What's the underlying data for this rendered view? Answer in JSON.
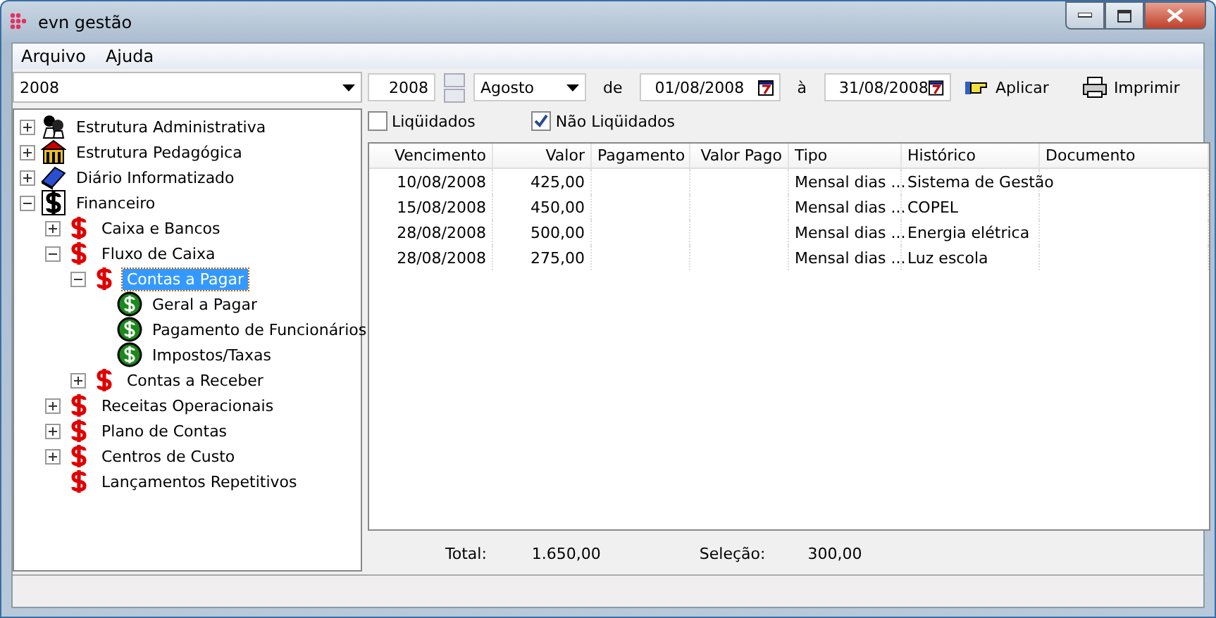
{
  "window": {
    "title": "evn gestão"
  },
  "menu": [
    "Arquivo",
    "Ajuda"
  ],
  "year_combo": {
    "value": "2008"
  },
  "toolbar": {
    "year": "2008",
    "month": "Agosto",
    "from_label": "de",
    "from_date": "01/08/2008",
    "to_label": "à",
    "to_date": "31/08/2008",
    "apply": "Aplicar",
    "print": "Imprimir"
  },
  "filters": [
    {
      "label": "Liqüidados",
      "checked": false
    },
    {
      "label": "Não Liqüidados",
      "checked": true
    }
  ],
  "tree": [
    {
      "label": "Estrutura Administrativa",
      "kind": "admin",
      "expanded": false,
      "selected": false
    },
    {
      "label": "Estrutura Pedagógica",
      "kind": "school",
      "expanded": false,
      "selected": false
    },
    {
      "label": "Diário Informatizado",
      "kind": "book",
      "expanded": false,
      "selected": false
    },
    {
      "label": "Financeiro",
      "kind": "dollar-black",
      "expanded": true,
      "selected": false,
      "children": [
        {
          "label": "Caixa e Bancos",
          "kind": "dollar-red",
          "expanded": false,
          "selected": false
        },
        {
          "label": "Fluxo de Caixa",
          "kind": "dollar-red",
          "expanded": true,
          "selected": false,
          "children": [
            {
              "label": "Contas a Pagar",
              "kind": "dollar-red",
              "expanded": true,
              "selected": true,
              "children": [
                {
                  "label": "Geral a Pagar",
                  "kind": "dollar-green",
                  "selected": false
                },
                {
                  "label": "Pagamento de Funcionários",
                  "kind": "dollar-green",
                  "selected": false
                },
                {
                  "label": "Impostos/Taxas",
                  "kind": "dollar-green",
                  "selected": false
                }
              ]
            },
            {
              "label": "Contas a Receber",
              "kind": "dollar-red",
              "expanded": false,
              "selected": false
            }
          ]
        },
        {
          "label": "Receitas Operacionais",
          "kind": "dollar-red",
          "expanded": false,
          "selected": false
        },
        {
          "label": "Plano de Contas",
          "kind": "dollar-red",
          "expanded": false,
          "selected": false
        },
        {
          "label": "Centros de Custo",
          "kind": "dollar-red",
          "expanded": false,
          "selected": false
        },
        {
          "label": "Lançamentos Repetitivos",
          "kind": "dollar-red",
          "selected": false
        }
      ]
    }
  ],
  "table": {
    "columns": [
      "Vencimento",
      "Valor",
      "Pagamento",
      "Valor Pago",
      "Tipo",
      "Histórico",
      "Documento"
    ],
    "rows": [
      {
        "vencimento": "10/08/2008",
        "valor": "425,00",
        "tipo": "Mensal dias ...",
        "historico": "Sistema de Gestão"
      },
      {
        "vencimento": "15/08/2008",
        "valor": "450,00",
        "tipo": "Mensal dias ...",
        "historico": "COPEL"
      },
      {
        "vencimento": "28/08/2008",
        "valor": "500,00",
        "tipo": "Mensal dias ...",
        "historico": "Energia elétrica"
      },
      {
        "vencimento": "28/08/2008",
        "valor": "275,00",
        "tipo": "Mensal dias ...",
        "historico": "Luz escola"
      }
    ]
  },
  "totals": {
    "total_label": "Total:",
    "total": "1.650,00",
    "selection_label": "Seleção:",
    "selection": "300,00"
  }
}
